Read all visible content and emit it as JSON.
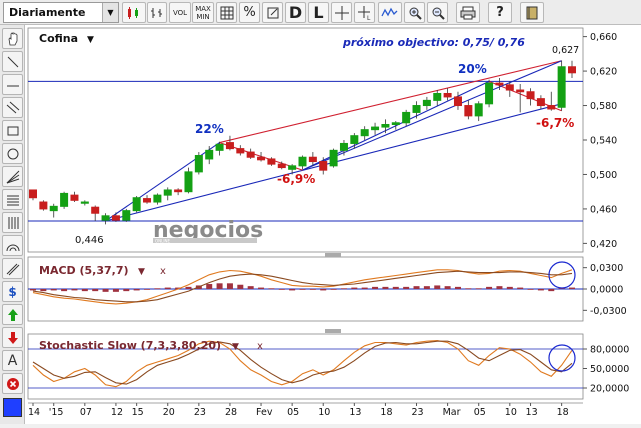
{
  "toolbar": {
    "period": "Diariamente",
    "vol_label": "VOL",
    "maxmin_label_top": "MAX",
    "maxmin_label_bottom": "MIN",
    "percent_label": "%",
    "d_label": "D",
    "l_label": "L",
    "plus_label": "+",
    "question_label": "?",
    "icons": [
      "candlestick-icon",
      "bar-chart-icon",
      "line-icon",
      "grid-icon",
      "percent-icon",
      "crosshair-icon",
      "crosshair-l-icon",
      "wave-icon",
      "zoom-in-icon",
      "zoom-out-icon",
      "print-icon",
      "help-icon",
      "open-window-icon"
    ]
  },
  "sidebar": {
    "tools": [
      "hand-icon",
      "line-tool-icon",
      "line-tool-2-icon",
      "parallel-lines-icon",
      "rectangle-icon",
      "circle-icon",
      "fan-icon",
      "fibonacci-icon",
      "grid-tool-icon",
      "arc-icon",
      "channel-icon",
      "dollar-icon",
      "arrow-up-icon",
      "arrow-down-icon",
      "text-icon",
      "delete-icon"
    ],
    "text_tool_label": "A",
    "dollar_label": "$",
    "swatch_color": "#1f3fff"
  },
  "main_chart": {
    "title": "Cofina",
    "title_arrow": "▼",
    "objective_text": "próximo objectivo: 0,75/ 0,76",
    "last_price_label": "0,627",
    "low_label": "0,446",
    "watermark": "negocios",
    "watermark_sub": "ONLINE",
    "annotations": [
      {
        "text": "22%",
        "color": "#1030c0"
      },
      {
        "text": "-6,9%",
        "color": "#d01010"
      },
      {
        "text": "20%",
        "color": "#1030c0"
      },
      {
        "text": "-6,7%",
        "color": "#d01010"
      }
    ],
    "y_ticks": [
      "0,660",
      "0,620",
      "0,580",
      "0,540",
      "0,500",
      "0,460",
      "0,420"
    ],
    "colors": {
      "up": "#14a014",
      "down": "#c81e1e",
      "trend_red": "#d02030",
      "trend_blue": "#1a28b8"
    }
  },
  "macd": {
    "title": "MACD (5,37,7)",
    "arrow": "▼",
    "close": "x",
    "y_ticks": [
      "0,0300",
      "0,0000",
      "-0,0300"
    ]
  },
  "stochastic": {
    "title": "Stochastic Slow (7,3,3,80,20)",
    "arrow": "▼",
    "close": "x",
    "y_ticks": [
      "80,0000",
      "50,0000",
      "20,0000"
    ]
  },
  "x_axis": {
    "labels": [
      "14",
      "'15",
      "07",
      "12",
      "15",
      "20",
      "23",
      "28",
      "Fev",
      "05",
      "10",
      "13",
      "18",
      "23",
      "Mar",
      "05",
      "10",
      "13",
      "18"
    ]
  },
  "chart_data": {
    "type": "candlestick",
    "title": "Cofina",
    "series": [
      {
        "name": "Cofina",
        "ohlc": [
          [
            0.482,
            0.482,
            0.47,
            0.473
          ],
          [
            0.468,
            0.47,
            0.458,
            0.46
          ],
          [
            0.458,
            0.466,
            0.45,
            0.463
          ],
          [
            0.463,
            0.48,
            0.46,
            0.478
          ],
          [
            0.476,
            0.48,
            0.468,
            0.47
          ],
          [
            0.468,
            0.47,
            0.464,
            0.468
          ],
          [
            0.462,
            0.464,
            0.446,
            0.455
          ],
          [
            0.447,
            0.455,
            0.442,
            0.452
          ],
          [
            0.452,
            0.456,
            0.445,
            0.447
          ],
          [
            0.447,
            0.46,
            0.445,
            0.458
          ],
          [
            0.458,
            0.475,
            0.456,
            0.473
          ],
          [
            0.472,
            0.476,
            0.466,
            0.468
          ],
          [
            0.468,
            0.478,
            0.465,
            0.476
          ],
          [
            0.476,
            0.485,
            0.47,
            0.482
          ],
          [
            0.482,
            0.484,
            0.476,
            0.48
          ],
          [
            0.48,
            0.508,
            0.478,
            0.503
          ],
          [
            0.503,
            0.526,
            0.5,
            0.522
          ],
          [
            0.518,
            0.533,
            0.512,
            0.528
          ],
          [
            0.528,
            0.538,
            0.522,
            0.535
          ],
          [
            0.537,
            0.545,
            0.528,
            0.53
          ],
          [
            0.53,
            0.534,
            0.522,
            0.525
          ],
          [
            0.526,
            0.53,
            0.518,
            0.52
          ],
          [
            0.52,
            0.526,
            0.515,
            0.517
          ],
          [
            0.518,
            0.52,
            0.51,
            0.512
          ],
          [
            0.512,
            0.515,
            0.506,
            0.508
          ],
          [
            0.506,
            0.512,
            0.5,
            0.51
          ],
          [
            0.51,
            0.522,
            0.506,
            0.52
          ],
          [
            0.52,
            0.526,
            0.51,
            0.515
          ],
          [
            0.515,
            0.52,
            0.5,
            0.505
          ],
          [
            0.51,
            0.53,
            0.508,
            0.528
          ],
          [
            0.528,
            0.54,
            0.522,
            0.536
          ],
          [
            0.536,
            0.548,
            0.53,
            0.545
          ],
          [
            0.545,
            0.556,
            0.54,
            0.552
          ],
          [
            0.552,
            0.56,
            0.546,
            0.555
          ],
          [
            0.555,
            0.564,
            0.548,
            0.558
          ],
          [
            0.558,
            0.562,
            0.552,
            0.56
          ],
          [
            0.56,
            0.575,
            0.556,
            0.572
          ],
          [
            0.572,
            0.585,
            0.565,
            0.58
          ],
          [
            0.58,
            0.59,
            0.575,
            0.586
          ],
          [
            0.586,
            0.598,
            0.58,
            0.594
          ],
          [
            0.594,
            0.6,
            0.586,
            0.59
          ],
          [
            0.59,
            0.596,
            0.575,
            0.58
          ],
          [
            0.58,
            0.586,
            0.564,
            0.568
          ],
          [
            0.568,
            0.585,
            0.562,
            0.582
          ],
          [
            0.582,
            0.61,
            0.578,
            0.606
          ],
          [
            0.606,
            0.612,
            0.598,
            0.604
          ],
          [
            0.604,
            0.608,
            0.59,
            0.598
          ],
          [
            0.598,
            0.605,
            0.572,
            0.596
          ],
          [
            0.596,
            0.6,
            0.58,
            0.588
          ],
          [
            0.588,
            0.592,
            0.576,
            0.58
          ],
          [
            0.58,
            0.596,
            0.574,
            0.576
          ],
          [
            0.578,
            0.632,
            0.574,
            0.625
          ],
          [
            0.625,
            0.632,
            0.612,
            0.618
          ]
        ]
      }
    ],
    "ylim": [
      0.41,
      0.67
    ],
    "horizontal_levels": [
      0.608,
      0.446
    ],
    "ylabel": ""
  }
}
